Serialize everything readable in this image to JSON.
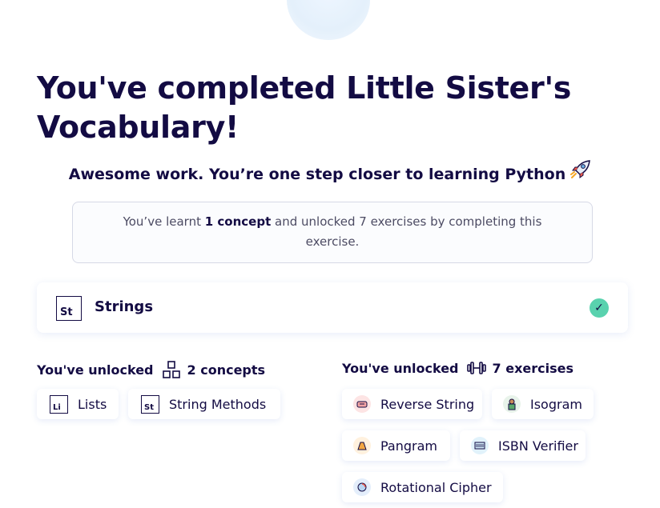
{
  "hero": {
    "illustration": "completed-exercise-illustration"
  },
  "title": "You've completed Little Sister's Vocabulary!",
  "subtitle": "Awesome work. You’re one step closer to learning Python",
  "subtitle_icon": "rocket-icon",
  "summary": {
    "prefix": "You’ve learnt ",
    "highlight": "1 concept",
    "suffix": " and unlocked 7 exercises by completing this exercise."
  },
  "learnt_concept": {
    "symbol": "St",
    "name": "Strings",
    "status_icon": "check-icon",
    "status_color": "#59d2ae"
  },
  "unlocked_concepts": {
    "label": "You've unlocked",
    "icon": "concepts-icon",
    "count_label": "2 concepts",
    "items": [
      {
        "symbol": "Li",
        "name": "Lists"
      },
      {
        "symbol": "St",
        "name": "String Methods"
      }
    ]
  },
  "unlocked_exercises": {
    "label": "You've unlocked",
    "icon": "dumbbell-icon",
    "count_label": "7 exercises",
    "items": [
      {
        "name": "Reverse String",
        "icon": "reverse-string-icon"
      },
      {
        "name": "Isogram",
        "icon": "isogram-icon"
      },
      {
        "name": "Pangram",
        "icon": "pangram-icon"
      },
      {
        "name": "ISBN Verifier",
        "icon": "isbn-verifier-icon"
      },
      {
        "name": "Rotational Cipher",
        "icon": "rotational-cipher-icon"
      }
    ]
  },
  "colors": {
    "heading": "#130b43",
    "success": "#59d2ae",
    "muted_text": "#4c4b63"
  }
}
